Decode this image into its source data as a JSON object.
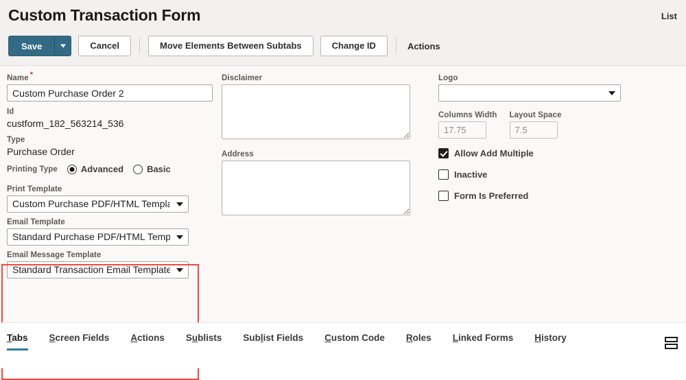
{
  "header": {
    "title": "Custom Transaction Form",
    "list_link": "List"
  },
  "toolbar": {
    "save_label": "Save",
    "save_caret_icon": "chevron-down-icon",
    "cancel_label": "Cancel",
    "move_elements_label": "Move Elements Between Subtabs",
    "change_id_label": "Change ID",
    "actions_label": "Actions"
  },
  "form": {
    "name": {
      "label": "Name",
      "required_marker": "*",
      "value": "Custom Purchase Order 2"
    },
    "id": {
      "label": "Id",
      "value": "custform_182_563214_536"
    },
    "type": {
      "label": "Type",
      "value": "Purchase Order"
    },
    "printing_type": {
      "label": "Printing Type",
      "options": [
        "Advanced",
        "Basic"
      ],
      "selected": "Advanced"
    },
    "print_template": {
      "label": "Print Template",
      "value": "Custom Purchase PDF/HTML Template"
    },
    "email_template": {
      "label": "Email Template",
      "value": "Standard Purchase PDF/HTML Template"
    },
    "email_message_template": {
      "label": "Email Message Template",
      "value": "Standard Transaction Email Template"
    },
    "disclaimer": {
      "label": "Disclaimer",
      "value": ""
    },
    "address": {
      "label": "Address",
      "value": ""
    },
    "logo": {
      "label": "Logo",
      "value": ""
    },
    "columns_width": {
      "label": "Columns Width",
      "value": "17.75"
    },
    "layout_space": {
      "label": "Layout Space",
      "value": "7.5"
    },
    "allow_add_multiple": {
      "label": "Allow Add Multiple",
      "checked": true
    },
    "inactive": {
      "label": "Inactive",
      "checked": false
    },
    "form_is_preferred": {
      "label": "Form Is Preferred",
      "checked": false
    }
  },
  "highlight": {
    "color": "#f4453c"
  },
  "tabs": {
    "active": "Tabs",
    "items": [
      {
        "pre": "",
        "key": "T",
        "post": "abs"
      },
      {
        "pre": "",
        "key": "S",
        "post": "creen Fields"
      },
      {
        "pre": "",
        "key": "A",
        "post": "ctions"
      },
      {
        "pre": "S",
        "key": "u",
        "post": "blists"
      },
      {
        "pre": "Sub",
        "key": "l",
        "post": "ist Fields"
      },
      {
        "pre": "",
        "key": "C",
        "post": "ustom Code"
      },
      {
        "pre": "",
        "key": "R",
        "post": "oles"
      },
      {
        "pre": "",
        "key": "L",
        "post": "inked Forms"
      },
      {
        "pre": "",
        "key": "H",
        "post": "istory"
      }
    ],
    "layout_icon": "layout-rows-icon"
  },
  "colors": {
    "primary_button": "#336a84",
    "tab_active_underline": "#2e7aa8",
    "header_background": "#f2f1ef",
    "form_background": "#faf9f7"
  }
}
